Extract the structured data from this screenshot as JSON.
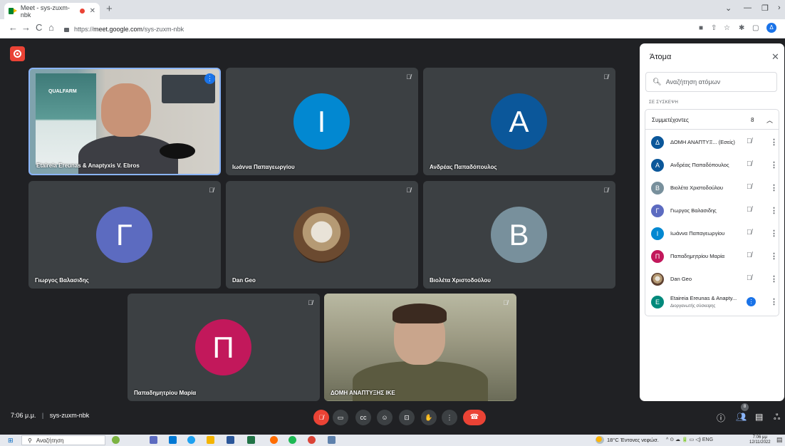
{
  "browser": {
    "tab_title": "Meet - sys-zuxm-nbk",
    "url_prefix": "https://",
    "url_host": "meet.google.com",
    "url_path": "/sys-zuxm-nbk",
    "profile_initial": "Δ"
  },
  "tiles": [
    {
      "name": "Etaireia Ereunas & Anaptyxis V. Ebros",
      "type": "video",
      "speaking": true
    },
    {
      "name": "Ιωάννα Παπαγεωργίου",
      "initial": "Ι",
      "color": "#0288d1",
      "muted": true
    },
    {
      "name": "Ανδρέας Παπαδόπουλος",
      "initial": "Α",
      "color": "#0b579a",
      "muted": true
    },
    {
      "name": "Γιωργος Βαλασιδης",
      "initial": "Γ",
      "color": "#5c6bc0",
      "muted": true
    },
    {
      "name": "Dan Geo",
      "type": "image-avatar",
      "muted": true
    },
    {
      "name": "Βιολέτα Χριστοδούλου",
      "initial": "Β",
      "color": "#78909c",
      "muted": true
    },
    {
      "name": "Παπαδημητρίου Μαρία",
      "initial": "Π",
      "color": "#c2185b",
      "muted": true
    },
    {
      "name": "ΔΟΜΗ ΑΝΑΠΤΥΞΗΣ ΙΚΕ",
      "type": "video",
      "muted": true
    }
  ],
  "panel": {
    "title": "Άτομα",
    "search_placeholder": "Αναζήτηση ατόμων",
    "section": "ΣΕ ΣΥΣΚΕΨΗ",
    "group_label": "Συμμετέχοντες",
    "group_count": "8",
    "participants": [
      {
        "name": "ΔΟΜΗ ΑΝΑΠΤΥΞ... (Εσείς)",
        "initial": "Δ",
        "color": "#0b579a"
      },
      {
        "name": "Ανδρέας Παπαδόπουλος",
        "initial": "Α",
        "color": "#0b579a"
      },
      {
        "name": "Βιολέτα Χριστοδούλου",
        "initial": "Β",
        "color": "#78909c"
      },
      {
        "name": "Γιωργος Βαλασιδης",
        "initial": "Γ",
        "color": "#5c6bc0"
      },
      {
        "name": "Ιωάννα Παπαγεωργίου",
        "initial": "Ι",
        "color": "#0288d1"
      },
      {
        "name": "Παπαδημητρίου Μαρία",
        "initial": "Π",
        "color": "#c2185b"
      },
      {
        "name": "Dan Geo",
        "initial": "",
        "color": "#8d6e63"
      },
      {
        "name": "Etaireia Ereunas & Anapty...",
        "subtitle": "Διοργανωτής σύσκεψης",
        "initial": "E",
        "color": "#00897b"
      }
    ]
  },
  "bottom": {
    "time": "7:06 μ.μ.",
    "separator": "|",
    "meeting_code": "sys-zuxm-nbk",
    "people_count": "8"
  },
  "taskbar": {
    "search": "Αναζήτηση",
    "weather": "18°C Έντονες νεφώσ.",
    "lang": "ENG",
    "time": "7:06 μμ",
    "date": "12/11/2022"
  }
}
